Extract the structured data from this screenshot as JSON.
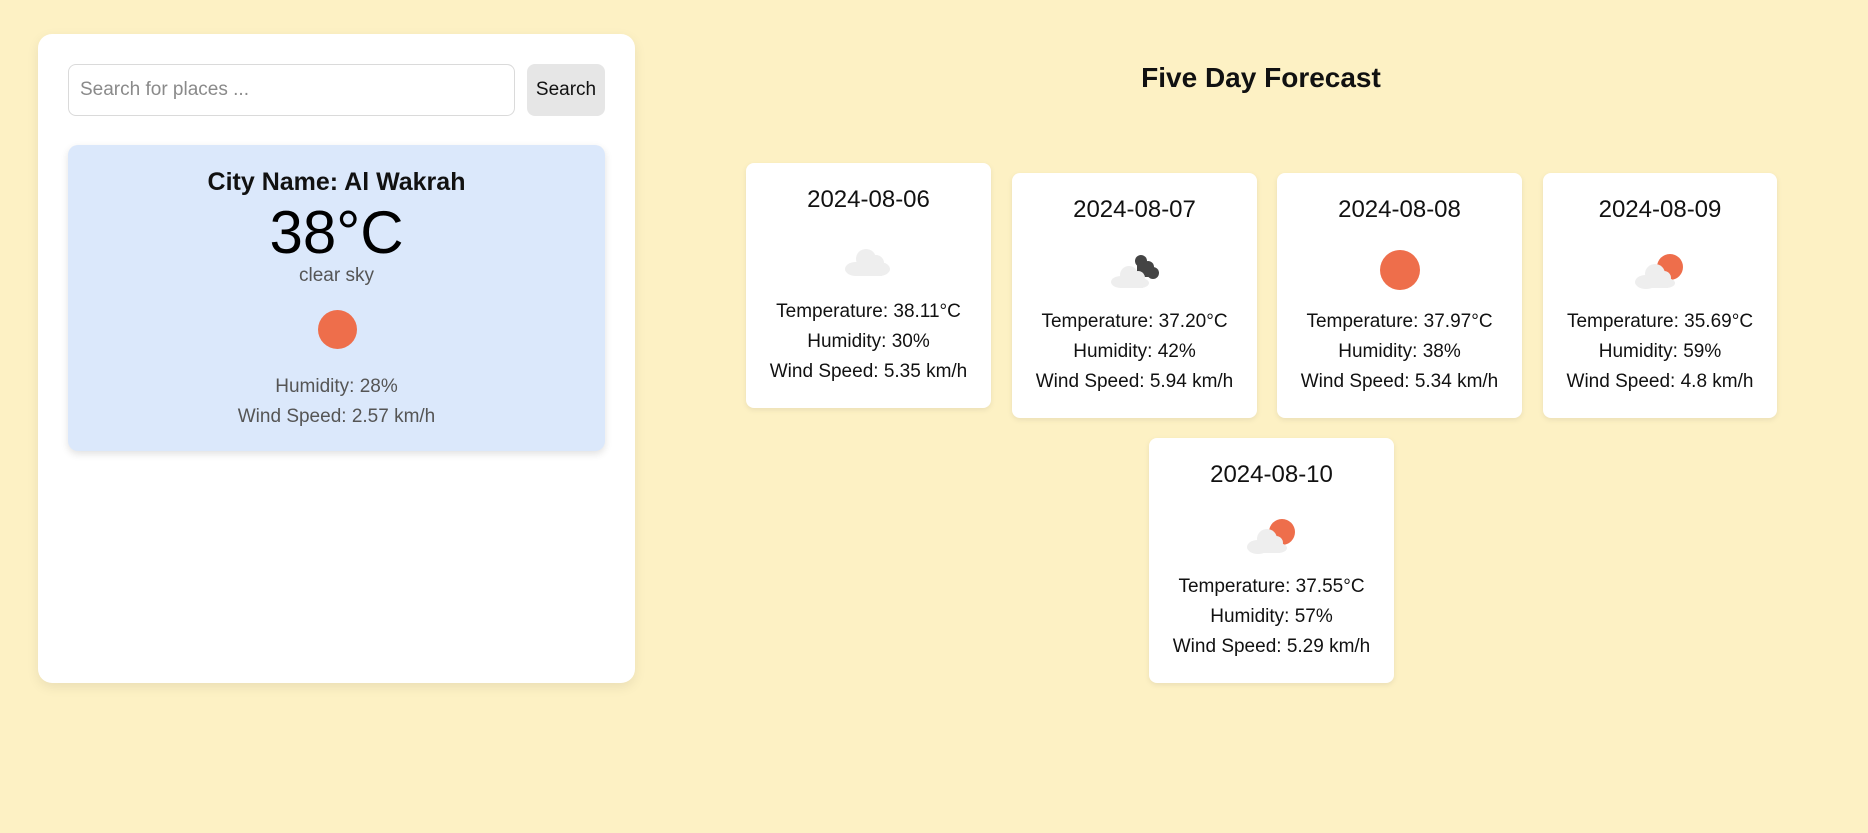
{
  "search": {
    "placeholder": "Search for places ...",
    "value": "",
    "button_label": "Search"
  },
  "current": {
    "city_label": "City Name: Al Wakrah",
    "temperature": "38°C",
    "condition": "clear sky",
    "icon": "sun-icon",
    "humidity": "Humidity: 28%",
    "wind": "Wind Speed: 2.57 km/h"
  },
  "forecast": {
    "title": "Five Day Forecast",
    "days": [
      {
        "date": "2024-08-06",
        "icon": "cloud-icon",
        "temperature": "Temperature: 38.11°C",
        "humidity": "Humidity: 30%",
        "wind": "Wind Speed: 5.35 km/h"
      },
      {
        "date": "2024-08-07",
        "icon": "broken-clouds-icon",
        "temperature": "Temperature: 37.20°C",
        "humidity": "Humidity: 42%",
        "wind": "Wind Speed: 5.94 km/h"
      },
      {
        "date": "2024-08-08",
        "icon": "sun-icon",
        "temperature": "Temperature: 37.97°C",
        "humidity": "Humidity: 38%",
        "wind": "Wind Speed: 5.34 km/h"
      },
      {
        "date": "2024-08-09",
        "icon": "partly-cloudy-icon",
        "temperature": "Temperature: 35.69°C",
        "humidity": "Humidity: 59%",
        "wind": "Wind Speed: 4.8 km/h"
      },
      {
        "date": "2024-08-10",
        "icon": "partly-cloudy-icon",
        "temperature": "Temperature: 37.55°C",
        "humidity": "Humidity: 57%",
        "wind": "Wind Speed: 5.29 km/h"
      }
    ]
  },
  "colors": {
    "page_background": "#fdf1c4",
    "current_card_background": "#dbe8fb",
    "sun": "#ee6e4b",
    "cloud_light": "#eeeeee",
    "cloud_dark": "#444444"
  }
}
